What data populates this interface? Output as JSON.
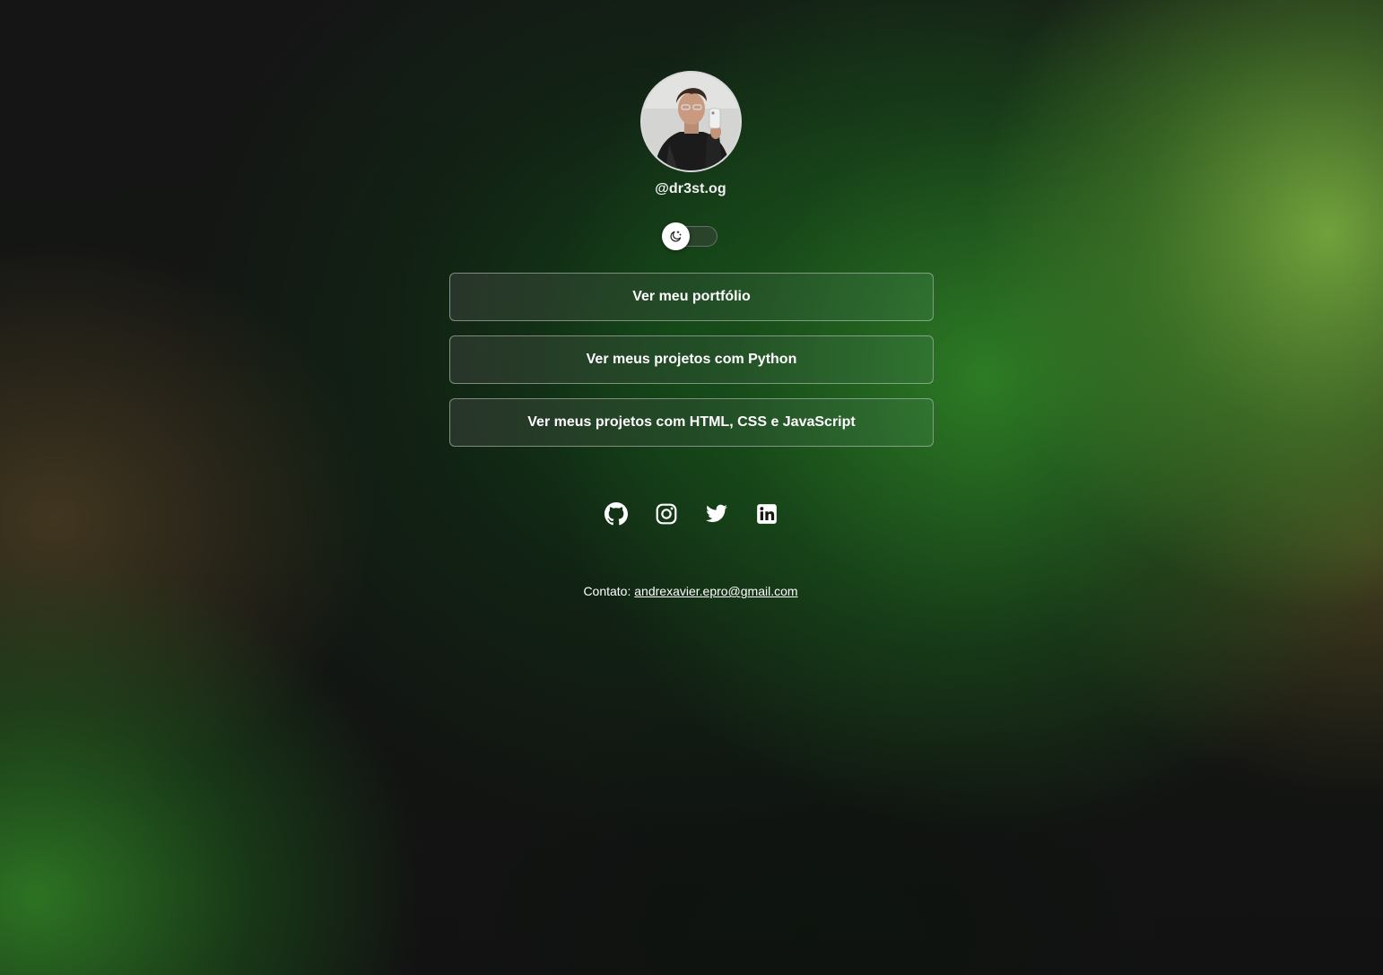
{
  "profile": {
    "username": "@dr3st.og",
    "avatar_alt": "profile photo"
  },
  "theme_toggle": {
    "icon": "moon-icon",
    "state": "dark"
  },
  "links": [
    {
      "label": "Ver meu portfólio"
    },
    {
      "label": "Ver meus projetos com Python"
    },
    {
      "label": "Ver meus projetos com HTML, CSS e JavaScript"
    }
  ],
  "socials": [
    {
      "icon": "github-icon"
    },
    {
      "icon": "instagram-icon"
    },
    {
      "icon": "twitter-icon"
    },
    {
      "icon": "linkedin-icon"
    }
  ],
  "contact": {
    "prefix": "Contato:",
    "email": "andrexavier.epro@gmail.com"
  },
  "colors": {
    "accent_green": "#3f8a34",
    "text": "#ffffff",
    "background": "#121212"
  }
}
